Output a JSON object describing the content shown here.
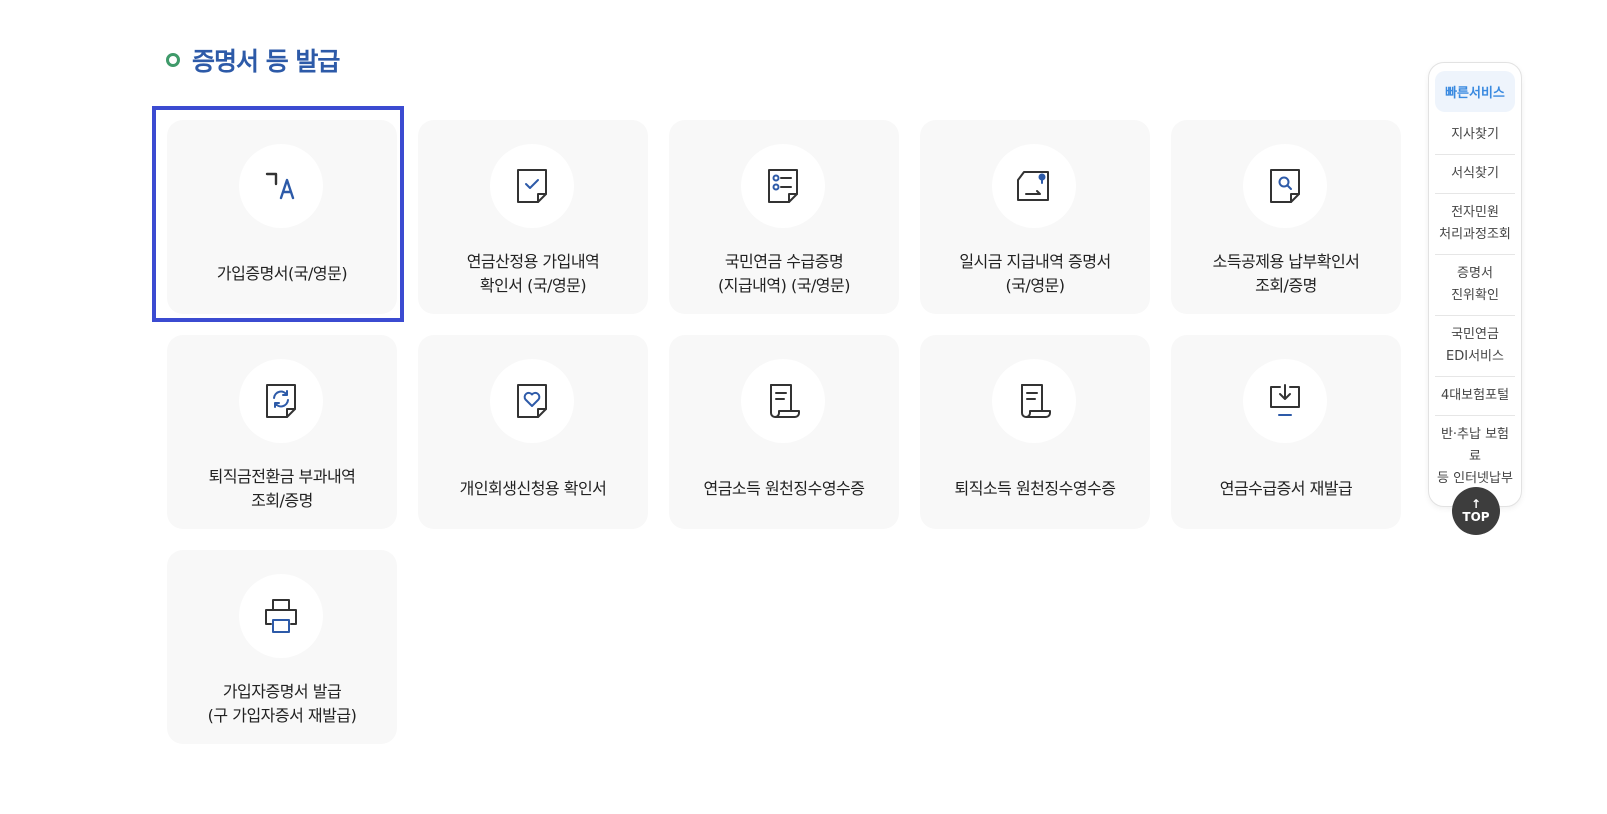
{
  "section": {
    "title": "증명서 등 발급"
  },
  "cards": [
    {
      "label": "가입증명서(국/영문)",
      "icon": "translate-icon"
    },
    {
      "label": "연금산정용 가입내역\n확인서 (국/영문)",
      "icon": "document-check-icon"
    },
    {
      "label": "국민연금 수급증명\n(지급내역) (국/영문)",
      "icon": "document-list-icon"
    },
    {
      "label": "일시금 지급내역 증명서\n(국/영문)",
      "icon": "document-pin-icon"
    },
    {
      "label": "소득공제용 납부확인서\n조회/증명",
      "icon": "document-search-icon"
    },
    {
      "label": "퇴직금전환금 부과내역\n조회/증명",
      "icon": "document-refresh-icon"
    },
    {
      "label": "개인회생신청용 확인서",
      "icon": "document-heart-icon"
    },
    {
      "label": "연금소득 원천징수영수증",
      "icon": "receipt-icon"
    },
    {
      "label": "퇴직소득 원천징수영수증",
      "icon": "receipt-icon"
    },
    {
      "label": "연금수급증서 재발급",
      "icon": "download-monitor-icon"
    },
    {
      "label": "가입자증명서 발급\n(구 가입자증서 재발급)",
      "icon": "printer-icon"
    }
  ],
  "quick_menu": {
    "title": "빠른서비스",
    "items": [
      "지사찾기",
      "서식찾기",
      "전자민원\n처리과정조회",
      "증명서\n진위확인",
      "국민연금\nEDI서비스",
      "4대보험포털",
      "반·추납 보험료\n등 인터넷납부"
    ]
  },
  "top_button": {
    "arrow": "↑",
    "label": "TOP"
  },
  "colors": {
    "title": "#2d5aa8",
    "dot": "#3f9a6a",
    "focus": "#3b4bd1",
    "accent": "#3a8ae0",
    "icon": "#333333"
  }
}
